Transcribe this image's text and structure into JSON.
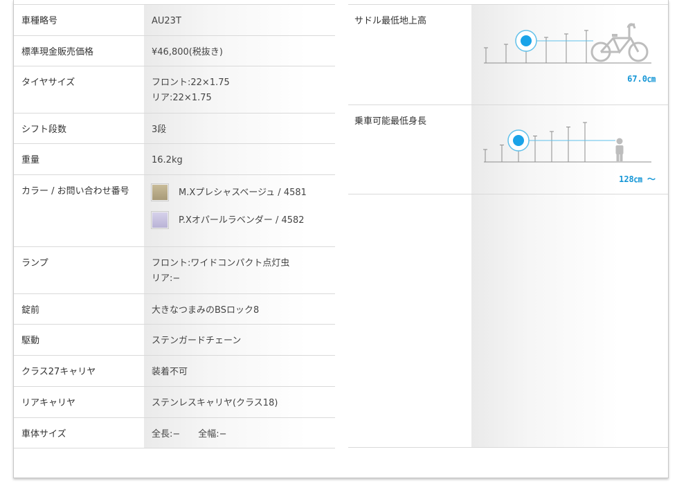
{
  "spec_table": {
    "rows": [
      {
        "label": "車種略号",
        "value_lines": [
          "AU23T"
        ]
      },
      {
        "label": "標準現金販売価格",
        "value_lines": [
          "¥46,800(税抜き)"
        ]
      },
      {
        "label": "タイヤサイズ",
        "value_lines": [
          "フロント:22×1.75",
          "リア:22×1.75"
        ]
      },
      {
        "label": "シフト段数",
        "value_lines": [
          "3段"
        ]
      },
      {
        "label": "重量",
        "value_lines": [
          "16.2kg"
        ]
      },
      {
        "label": "カラー / お問い合わせ番号",
        "value_lines": []
      },
      {
        "label": "ランプ",
        "value_lines": [
          "フロント:ワイドコンパクト点灯虫",
          "リア:−"
        ]
      },
      {
        "label": "錠前",
        "value_lines": [
          "大きなつまみのBSロック8"
        ]
      },
      {
        "label": "駆動",
        "value_lines": [
          "ステンガードチェーン"
        ]
      },
      {
        "label": "クラス27キャリヤ",
        "value_lines": [
          "装着不可"
        ]
      },
      {
        "label": "リアキャリヤ",
        "value_lines": [
          "ステンレスキャリヤ(クラス18)"
        ]
      },
      {
        "label": "車体サイズ",
        "value_lines": [
          "全長:−　　全幅:−"
        ]
      }
    ],
    "colors": [
      {
        "name": "M.Xプレシャスベージュ / 4581",
        "swatch": "#a89a78",
        "swatch_light": "#c8bb98"
      },
      {
        "name": "P.Xオパールラベンダー / 4582",
        "swatch": "#b9b3d6",
        "swatch_light": "#d6d1ea"
      }
    ]
  },
  "fit_table": {
    "saddle": {
      "label": "サドル最低地上高",
      "value": "67.0㎝",
      "level_index": 3,
      "total_levels": 6
    },
    "rider": {
      "label": "乗車可能最低身長",
      "value": "128㎝ 〜",
      "level_index": 3,
      "total_levels": 7
    }
  },
  "theme": {
    "accent": "#1596d6",
    "marker": "#1aa3e8",
    "guide": "#5fc0ea",
    "axis": "#8c8c8c",
    "figure": "#bdbdbd"
  }
}
